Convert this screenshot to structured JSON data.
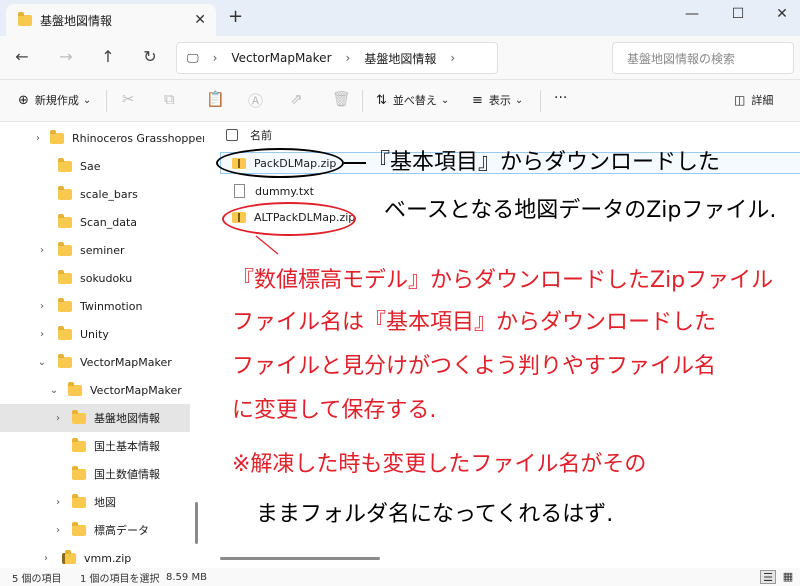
{
  "tab": {
    "title": "基盤地図情報",
    "close_glyph": "✕",
    "new_tab_glyph": "+"
  },
  "window_controls": {
    "minimize": "—",
    "maximize": "☐",
    "close": "✕"
  },
  "nav": {
    "back": "←",
    "forward": "→",
    "up": "↑",
    "refresh": "↻"
  },
  "address": {
    "computer_glyph": "🖵",
    "sep": "›",
    "crumbs": [
      "VectorMapMaker",
      "基盤地図情報"
    ]
  },
  "search": {
    "placeholder": "基盤地図情報の検索"
  },
  "toolbar": {
    "new_label": "新規作成",
    "new_glyph": "⊕",
    "sort_label": "並べ替え",
    "sort_glyph": "⇅",
    "view_label": "表示",
    "view_glyph": "≡",
    "more_glyph": "···",
    "details_label": "詳細",
    "details_glyph": "◫",
    "dropdown_glyph": "⌄",
    "cut_glyph": "✂",
    "copy_glyph": "⧉",
    "paste_glyph": "📋",
    "rename_glyph": "Ⓐ",
    "share_glyph": "⇗",
    "delete_glyph": "🗑"
  },
  "sidebar": {
    "items": [
      {
        "label": "Rhinoceros Grasshopper",
        "chevron": "›"
      },
      {
        "label": "Sae",
        "chevron": ""
      },
      {
        "label": "scale_bars",
        "chevron": ""
      },
      {
        "label": "Scan_data",
        "chevron": ""
      },
      {
        "label": "seminer",
        "chevron": "›"
      },
      {
        "label": "sokudoku",
        "chevron": ""
      },
      {
        "label": "Twinmotion",
        "chevron": "›"
      },
      {
        "label": "Unity",
        "chevron": "›"
      },
      {
        "label": "VectorMapMaker",
        "chevron": "⌄"
      },
      {
        "label": "VectorMapMaker",
        "chevron": "⌄"
      },
      {
        "label": "基盤地図情報",
        "chevron": "›"
      },
      {
        "label": "国土基本情報",
        "chevron": ""
      },
      {
        "label": "国土数値情報",
        "chevron": ""
      },
      {
        "label": "地図",
        "chevron": "›"
      },
      {
        "label": "標高データ",
        "chevron": "›"
      },
      {
        "label": "vmm.zip",
        "chevron": "›"
      }
    ]
  },
  "columns": {
    "name": "名前"
  },
  "files": [
    {
      "name": "PackDLMap.zip",
      "type": "zip"
    },
    {
      "name": "dummy.txt",
      "type": "txt"
    },
    {
      "name": "ALTPackDLMap.zip",
      "type": "zip"
    }
  ],
  "annotations": {
    "black_line1": "『基本項目』からダウンロードした",
    "black_line2": "ベースとなる地図データのZipファイル.",
    "red_lines": [
      "『数値標高モデル』からダウンロードしたZipファイル",
      "ファイル名は『基本項目』からダウンロードした",
      "ファイルと見分けがつくよう判りやすファイル名",
      "に変更して保存する.",
      "※解凍した時も変更したファイル名がその",
      "ままフォルダ名になってくれるはず."
    ],
    "black_color": "#000000",
    "red_color": "#e0202a"
  },
  "status": {
    "count": "5 個の項目",
    "selected": "1 個の項目を選択",
    "size": "8.59 MB",
    "list_view_glyph": "☰",
    "tile_view_glyph": "▦"
  }
}
